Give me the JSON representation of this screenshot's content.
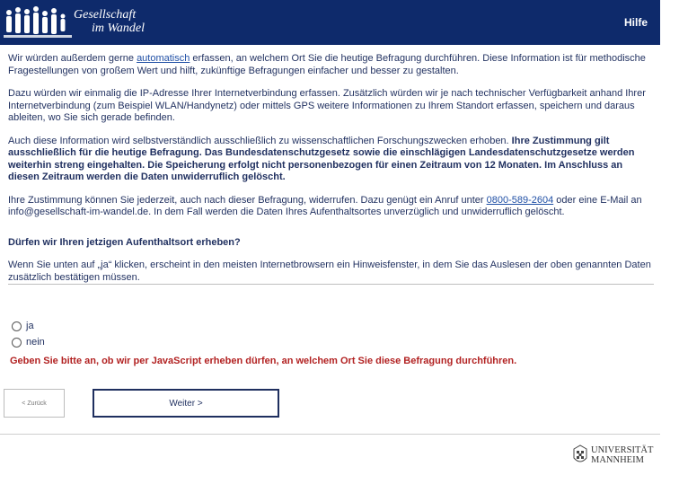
{
  "header": {
    "logo_line1": "Gesellschaft",
    "logo_line2": "im Wandel",
    "help_label": "Hilfe",
    "bg_color": "#0e2a6b"
  },
  "content": {
    "p1_before": "Wir würden außerdem gerne ",
    "p1_link": "automatisch",
    "p1_after": " erfassen, an welchem Ort Sie die heutige Befragung durchführen. Diese Information ist für methodische Fragestellungen von großem Wert und hilft, zukünftige Befragungen einfacher und besser zu gestalten.",
    "p2": "Dazu würden wir einmalig die IP-Adresse Ihrer Internetverbindung erfassen. Zusätzlich würden wir je nach technischer Verfügbarkeit anhand Ihrer Internetverbindung (zum Beispiel WLAN/Handynetz) oder mittels GPS weitere Informationen zu Ihrem Standort erfassen, speichern und daraus ableiten, wo Sie sich gerade befinden.",
    "p3_normal": "Auch diese Information wird selbstverständlich ausschließlich zu wissenschaftlichen Forschungszwecken erhoben. ",
    "p3_bold": "Ihre Zustimmung gilt ausschließlich für die heutige Befragung. Das Bundesdatenschutzgesetz sowie die einschlägigen Landesdatenschutzgesetze werden weiterhin streng eingehalten. Die Speicherung erfolgt nicht personenbezogen für einen Zeitraum von 12 Monaten. Im Anschluss an diesen Zeitraum werden die Daten unwiderruflich gelöscht.",
    "p4_before": "Ihre Zustimmung können Sie jederzeit, auch nach dieser Befragung, widerrufen. Dazu genügt ein Anruf unter ",
    "p4_phone": "0800-589-2604",
    "p4_after": " oder eine E-Mail an info@gesellschaft-im-wandel.de. In dem Fall werden die Daten Ihres Aufenthaltsortes unverzüglich und unwiderruflich gelöscht.",
    "question": "Dürfen wir Ihren jetzigen Aufenthaltsort erheben?",
    "p5": "Wenn Sie unten auf „ja“ klicken, erscheint in den meisten Internetbrowsern ein Hinweisfenster, in dem Sie das Auslesen der oben genannten Daten zusätzlich bestätigen müssen."
  },
  "options": {
    "yes": "ja",
    "no": "nein"
  },
  "error_message": "Geben Sie bitte an, ob wir per JavaScript erheben dürfen, an welchem Ort Sie diese Befragung durchführen.",
  "nav": {
    "back_label": "< Zurück",
    "next_label": "Weiter >"
  },
  "footer": {
    "uni_line1": "UNIVERSITÄT",
    "uni_line2": "MANNHEIM"
  },
  "colors": {
    "text": "#1f2f5f",
    "error": "#b22222",
    "link": "#1f4fa5"
  }
}
